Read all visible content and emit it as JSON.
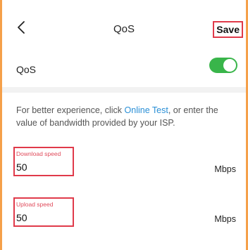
{
  "header": {
    "title": "QoS",
    "save_label": "Save"
  },
  "qos": {
    "label": "QoS",
    "enabled": true
  },
  "description": {
    "prefix": "For better experience, click ",
    "link_text": "Online Test",
    "suffix": ", or enter the value of bandwidth provided by your ISP."
  },
  "download": {
    "label": "Download speed",
    "value": "50",
    "unit": "Mbps"
  },
  "upload": {
    "label": "Upload speed",
    "value": "50",
    "unit": "Mbps"
  },
  "colors": {
    "accent": "#39b54a",
    "link": "#2a8fd6",
    "highlight": "#e03a4a",
    "border": "#f5a04a"
  }
}
